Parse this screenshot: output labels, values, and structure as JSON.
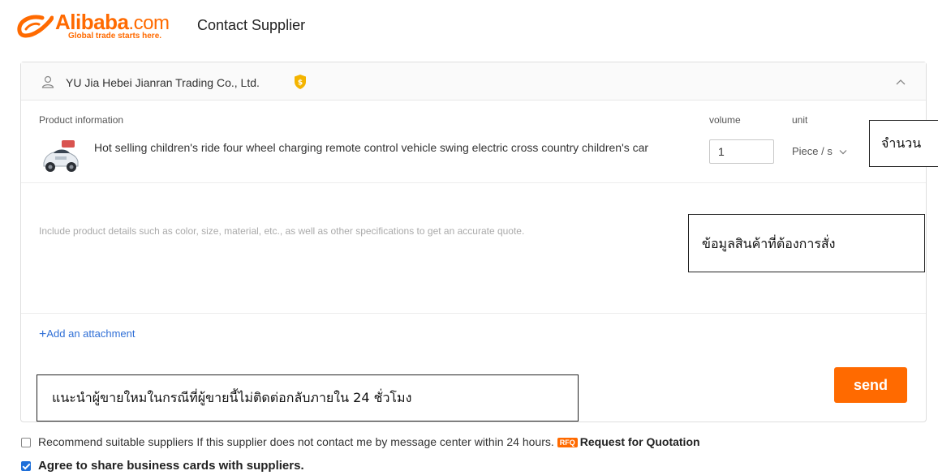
{
  "header": {
    "brand_name": "Alibaba",
    "brand_suffix": ".com",
    "brand_tagline": "Global trade starts here.",
    "page_title": "Contact Supplier",
    "brand_color": "#ff6a00"
  },
  "supplier": {
    "name": "YU Jia Hebei Jianran Trading Co., Ltd.",
    "user_icon": "user-icon",
    "badge_icon": "verified-shield-icon",
    "collapse_icon": "chevron-up-icon"
  },
  "product": {
    "section_label": "Product information",
    "volume_label": "volume",
    "unit_label": "unit",
    "title": "Hot selling children's ride four wheel charging remote control vehicle swing electric cross country children's car",
    "volume_value": "1",
    "unit_value": "Piece / s"
  },
  "message": {
    "placeholder": "Include product details such as color, size, material, etc., as well as other specifications to get an accurate quote."
  },
  "attachment": {
    "plus": "+",
    "label": "Add an attachment"
  },
  "send_label": "send",
  "options": {
    "recommend_text": "Recommend suitable suppliers If this supplier does not contact me by message center within 24 hours.",
    "rfq_badge": "RFQ",
    "rfq_label": "Request for Quotation",
    "recommend_checked": false,
    "share_text": "Agree to share business cards with suppliers.",
    "share_checked": true
  },
  "annotations": {
    "quantity": "จำนวน",
    "details": "ข้อมูลสินค้าที่ต้องการสั่ง",
    "recommend": "แนะนำผู้ขายใหมในกรณีที่ผู้ขายนี้ไม่ติดต่อกลับภายใน 24 ชั่วโมง"
  }
}
